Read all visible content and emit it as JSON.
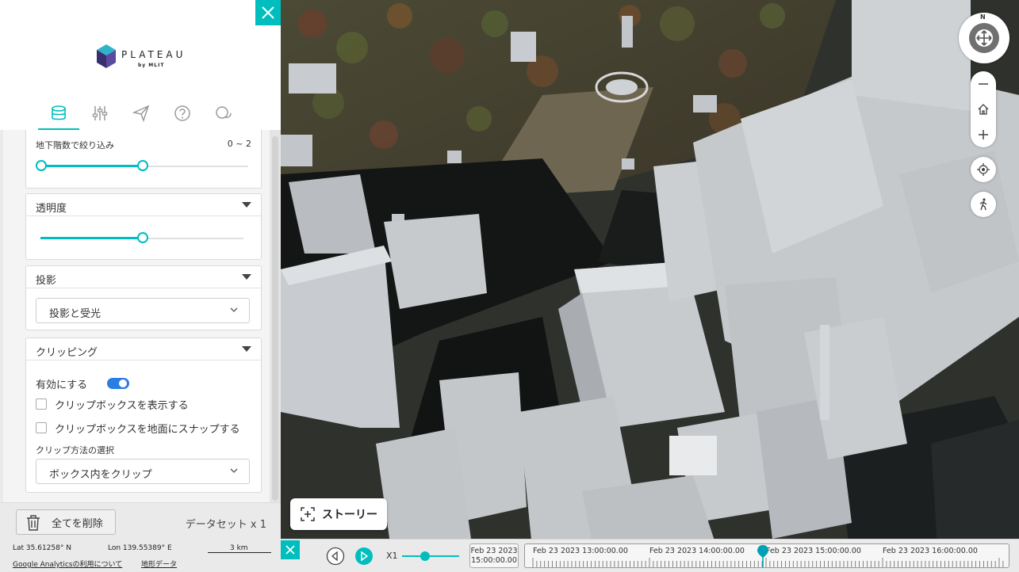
{
  "panel": {
    "logo_text": "PLATEAU",
    "logo_sub": "by MLIT",
    "tabs": [
      {
        "name": "data",
        "icon": "database-icon",
        "active": true
      },
      {
        "name": "settings",
        "icon": "sliders-icon",
        "active": false
      },
      {
        "name": "share",
        "icon": "paper-plane-icon",
        "active": false
      },
      {
        "name": "help",
        "icon": "question-icon",
        "active": false
      },
      {
        "name": "feedback",
        "icon": "chat-icon",
        "active": false
      }
    ],
    "underground_filter": {
      "label": "地下階数で絞り込み",
      "range_text": "0 ~ 2",
      "min_fraction": 0.0,
      "max_fraction": 0.5
    },
    "transparency": {
      "label": "透明度",
      "value_fraction": 0.5
    },
    "shadow": {
      "label": "投影",
      "selected": "投影と受光"
    },
    "clipping": {
      "label": "クリッピング",
      "enable_label": "有効にする",
      "enabled": true,
      "show_box_label": "クリップボックスを表示する",
      "snap_label": "クリップボックスを地面にスナップする",
      "method_label": "クリップ方法の選択",
      "method_selected": "ボックス内をクリップ"
    },
    "footer": {
      "delete_all": "全てを削除",
      "dataset_count": "データセット x 1"
    },
    "status": {
      "lat": "Lat  35.61258° N",
      "lon": "Lon  139.55389° E",
      "scale": "3 km",
      "analytics": "Google Analyticsの利用について",
      "terrain": "地形データ"
    }
  },
  "map": {
    "compass_north": "N",
    "story_button": "ストーリー"
  },
  "timeline": {
    "speed": "X1",
    "speed_fraction": 0.4,
    "current_date_line1": "Feb 23 2023",
    "current_date_line2": "15:00:00.00",
    "labels": [
      "Feb 23 2023 13:00:00.00",
      "Feb 23 2023 14:00:00.00",
      "Feb 23 2023 15:00:00.00",
      "Feb 23 2023 16:00:00.00"
    ],
    "cursor_fraction": 0.49
  },
  "colors": {
    "accent": "#00bebe",
    "building": "#c6cacd"
  }
}
